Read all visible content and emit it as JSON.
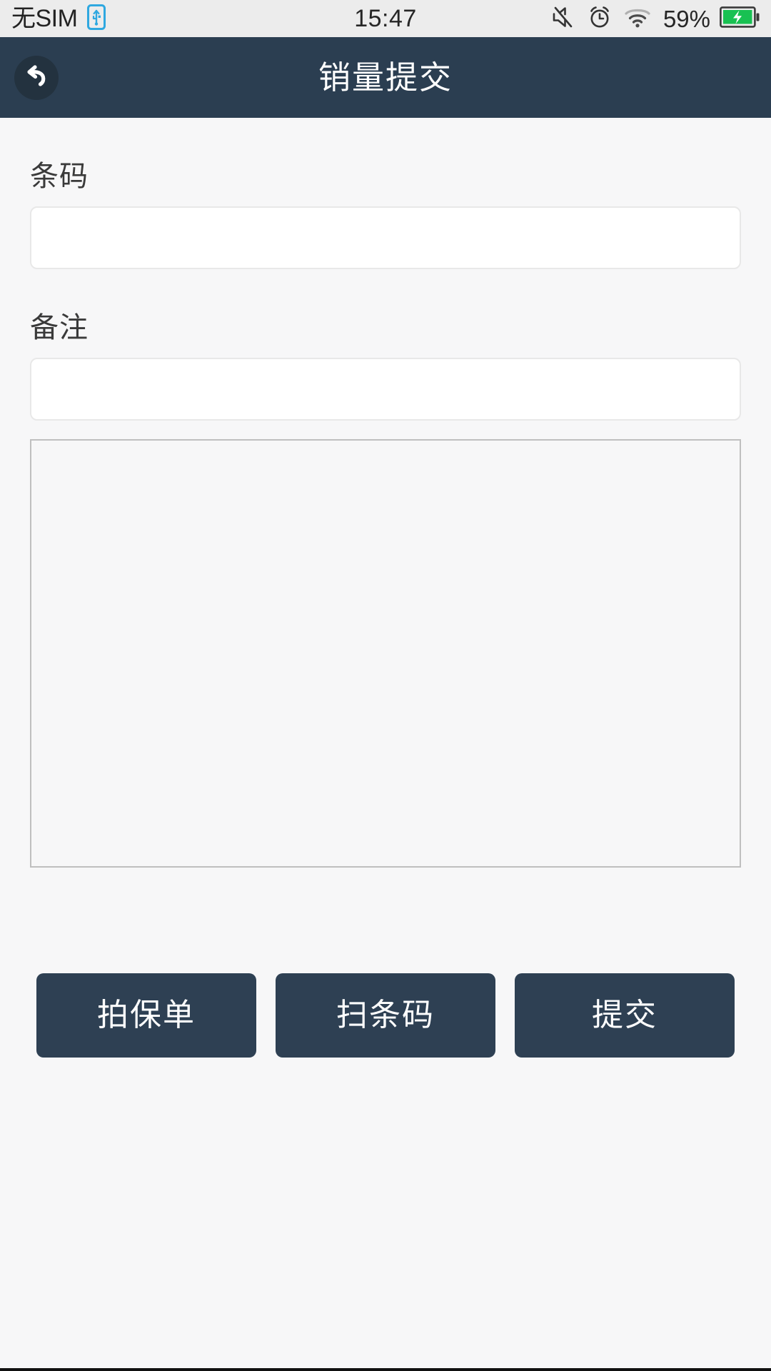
{
  "status_bar": {
    "carrier": "无SIM",
    "usb_icon": "usb-icon",
    "time": "15:47",
    "mute_icon": "mute-icon",
    "alarm_icon": "alarm-icon",
    "wifi_icon": "wifi-icon",
    "battery_percent": "59%",
    "battery_icon": "battery-charging-icon",
    "battery_color": "#18c152",
    "background": "#ececec"
  },
  "header": {
    "title": "销量提交",
    "back_icon": "back-arrow-icon",
    "background": "#2b3e51",
    "title_color": "#ffffff"
  },
  "form": {
    "barcode": {
      "label": "条码",
      "value": "",
      "placeholder": ""
    },
    "remark": {
      "label": "备注",
      "value": "",
      "placeholder": ""
    },
    "preview": {
      "name": "photo-preview-area",
      "content": ""
    }
  },
  "actions": {
    "photo_policy": "拍保单",
    "scan_barcode": "扫条码",
    "submit": "提交",
    "background": "#2e4053",
    "text_color": "#ffffff"
  },
  "page": {
    "background": "#f7f7f8"
  }
}
